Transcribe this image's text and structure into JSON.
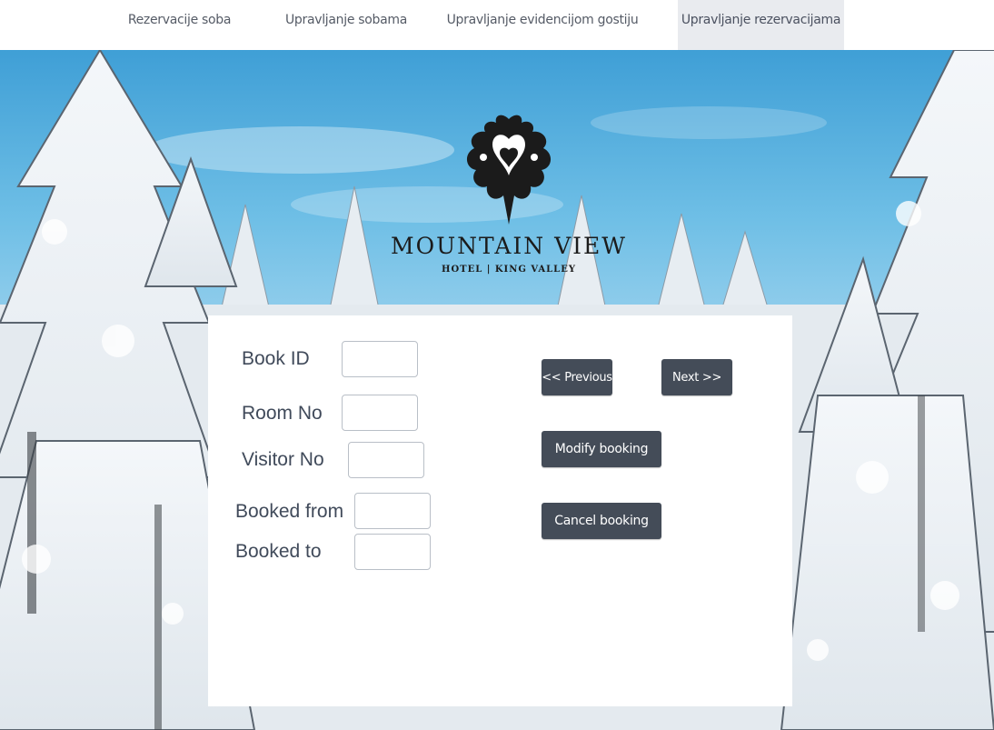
{
  "nav": {
    "items": [
      {
        "label": "Rezervacije soba"
      },
      {
        "label": "Upravljanje sobama"
      },
      {
        "label": "Upravljanje evidencijom gostiju"
      },
      {
        "label": "Upravljanje rezervacijama"
      }
    ],
    "active_index": 3
  },
  "logo": {
    "emblem_icon": "ornamental-heart-emblem",
    "title": "MOUNTAIN VIEW",
    "subtitle": "HOTEL | KING VALLEY"
  },
  "form": {
    "fields": [
      {
        "label": "Book ID",
        "value": ""
      },
      {
        "label": "Room No",
        "value": ""
      },
      {
        "label": "Visitor No",
        "value": ""
      },
      {
        "label": "Booked from",
        "value": ""
      },
      {
        "label": "Booked to",
        "value": ""
      }
    ]
  },
  "buttons": {
    "previous": "<< Previous",
    "next": "Next >>",
    "modify": "Modify booking",
    "cancel": "Cancel booking"
  },
  "colors": {
    "button_bg": "#444c58",
    "nav_active_bg": "#e9ebef",
    "label_text": "#404a5a"
  }
}
